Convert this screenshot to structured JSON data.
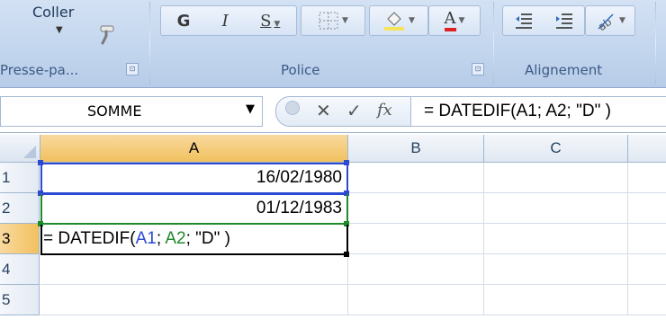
{
  "ribbon": {
    "clipboard": {
      "paste_label": "Coller",
      "group_label": "Presse-pa...",
      "launcher": "⊡"
    },
    "font": {
      "bold": "G",
      "italic": "I",
      "underline": "S",
      "font_color_letter": "A",
      "group_label": "Police",
      "launcher": "⊡"
    },
    "alignment": {
      "group_label": "Alignement"
    }
  },
  "formula_bar": {
    "name_box": "SOMME",
    "cancel": "✕",
    "enter": "✓",
    "fx": "fx",
    "formula": "= DATEDIF(A1; A2; \"D\" )"
  },
  "sheet": {
    "columns": [
      "A",
      "B",
      "C"
    ],
    "rows": [
      "1",
      "2",
      "3",
      "4",
      "5"
    ],
    "cells": {
      "A1": "16/02/1980",
      "A2": "01/12/1983",
      "A3_prefix": "= DATEDIF(",
      "A3_ref1": "A1",
      "A3_sep1": "; ",
      "A3_ref2": "A2",
      "A3_suffix": "; \"D\" )"
    }
  },
  "colors": {
    "ref1": "#2b4ad1",
    "ref2": "#1f8a2a",
    "active_header": "#f1c15f"
  }
}
